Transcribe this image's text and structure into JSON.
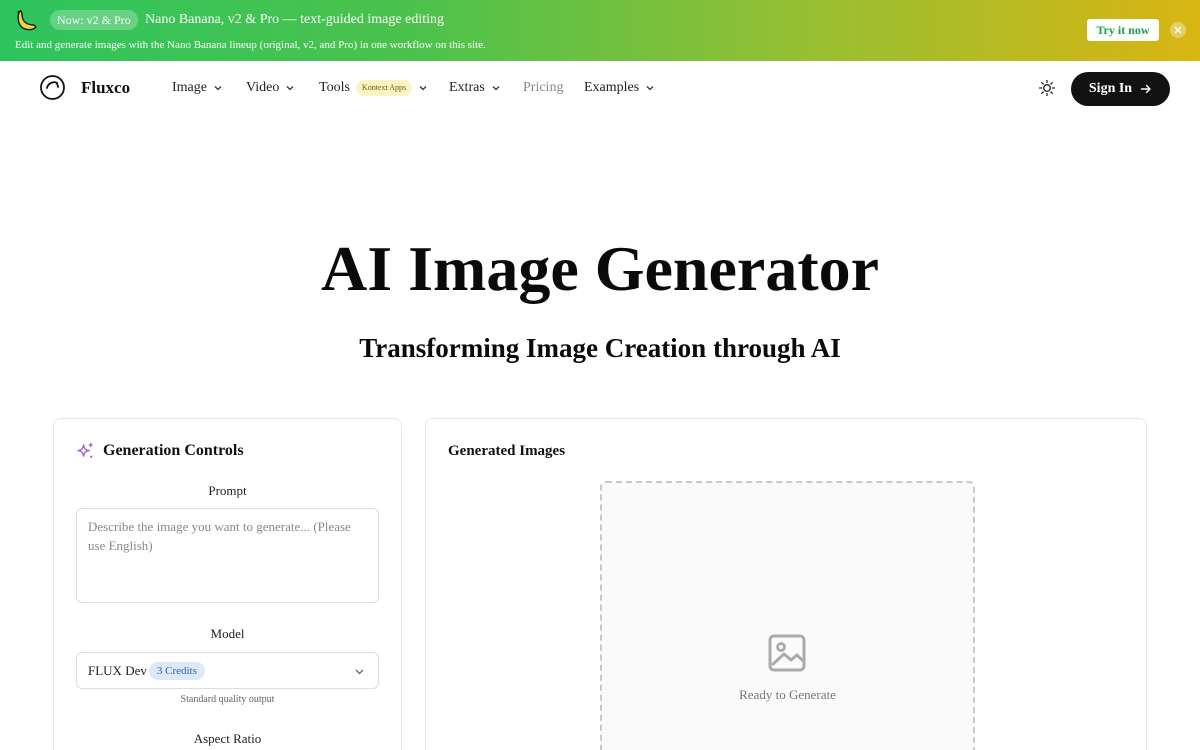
{
  "banner": {
    "pill": "Now: v2 & Pro",
    "title": "Nano Banana, v2 & Pro — text-guided image editing",
    "description": "Edit and generate images with the Nano Banana lineup (original, v2, and Pro) in one workflow on this site.",
    "cta": "Try it now",
    "logo_icon": "banana-icon",
    "close_icon": "close-icon"
  },
  "nav": {
    "brand": "Fluxco",
    "items": [
      {
        "label": "Image"
      },
      {
        "label": "Video"
      },
      {
        "label": "Tools",
        "badge": "Kontext Apps"
      },
      {
        "label": "Extras"
      },
      {
        "label": "Pricing"
      },
      {
        "label": "Examples"
      }
    ],
    "theme_icon": "sun-icon",
    "sign_in": "Sign In"
  },
  "hero": {
    "title": "AI Image Generator",
    "subtitle": "Transforming Image Creation through AI"
  },
  "controls": {
    "title": "Generation Controls",
    "prompt_label": "Prompt",
    "prompt_placeholder": "Describe the image you want to generate... (Please use English)",
    "prompt_value": "",
    "model_label": "Model",
    "model_value": "FLUX Dev",
    "model_credits": "3 Credits",
    "model_hint": "Standard quality output",
    "aspect_label": "Aspect Ratio"
  },
  "results": {
    "title": "Generated Images",
    "empty_text": "Ready to Generate",
    "empty_icon": "image-placeholder-icon"
  },
  "colors": {
    "banner_start": "#2ec45e",
    "banner_end": "#d9b512",
    "cta_text": "#18a34a",
    "sparkle": "#9b5de5",
    "credits_bg": "#dde9fb",
    "credits_text": "#2f5fb0",
    "tag_bg": "#fdf4c4"
  }
}
